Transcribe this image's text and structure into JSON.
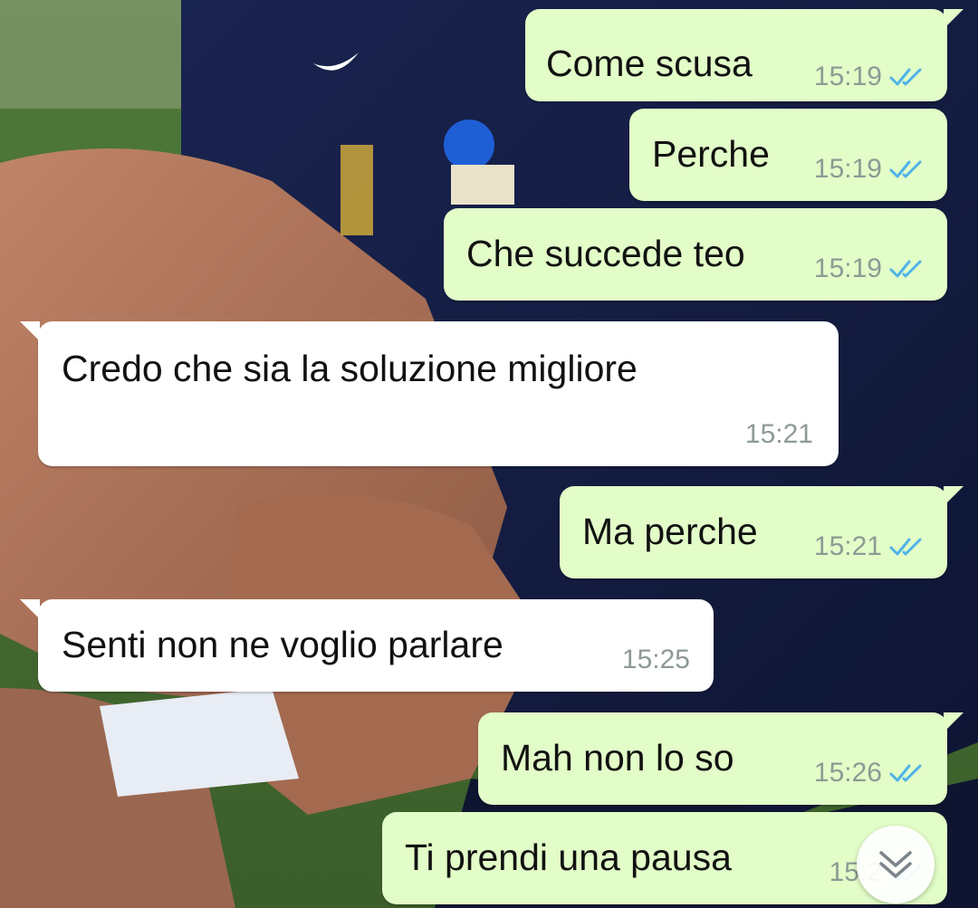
{
  "chat": {
    "messages": [
      {
        "direction": "outgoing",
        "text": "Come scusa",
        "time": "15:19",
        "status": "read"
      },
      {
        "direction": "outgoing",
        "text": "Perche",
        "time": "15:19",
        "status": "read"
      },
      {
        "direction": "outgoing",
        "text": "Che succede teo",
        "time": "15:19",
        "status": "read"
      },
      {
        "direction": "incoming",
        "text": "Credo che sia la soluzione migliore",
        "time": "15:21"
      },
      {
        "direction": "outgoing",
        "text": "Ma perche",
        "time": "15:21",
        "status": "read"
      },
      {
        "direction": "incoming",
        "text": "Senti non ne voglio parlare",
        "time": "15:25"
      },
      {
        "direction": "outgoing",
        "text": "Mah non lo so",
        "time": "15:26",
        "status": "read"
      },
      {
        "direction": "outgoing",
        "text": "Ti prendi una pausa",
        "time": "15:2",
        "status": "read"
      }
    ]
  },
  "icons": {
    "read_receipt": "double-check-icon",
    "scroll_down": "chevron-double-down-icon"
  },
  "colors": {
    "outgoing_bubble": "#e2fdc8",
    "incoming_bubble": "#ffffff",
    "read_tick": "#4fb3e8",
    "timestamp": "#8d9a94"
  }
}
